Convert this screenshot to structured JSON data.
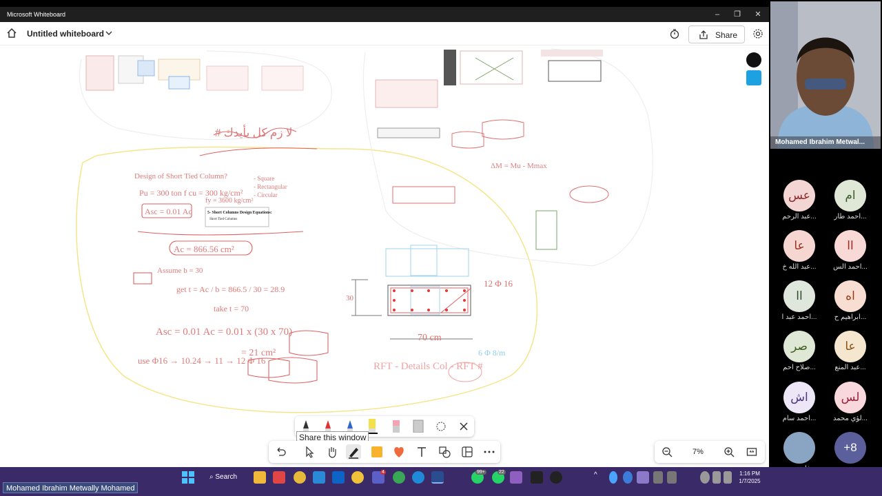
{
  "window": {
    "app_title": "Microsoft Whiteboard",
    "doc_title": "Untitled whiteboard",
    "share_label": "Share"
  },
  "board_notes": {
    "title_arabic": "# لا زم كل بأيدك",
    "design_heading": "Design of Short Tied Column?",
    "pu_line": "Pu = 300 ton  f cu = 300 kg/cm²",
    "fy_line": "fy = 3600 kg/cm²",
    "square": "- Square",
    "rectangular": "- Rectangular",
    "circular": "- Circular",
    "asc_formula": "Asc = 0.01 Ac",
    "eq_title": "5- Short Columns Design Equations:",
    "eq_subtitle": "Short Tied Columns",
    "ac_result": "Ac = 866.56 cm²",
    "assume": "Assume b = 30",
    "get_t": "get t = Ac / b = 866.5 / 30 = 28.9",
    "take": "take t = 70",
    "asc_calc": "Asc = 0.01 Ac = 0.01 x (30 x 70)",
    "asc_result": "= 21 cm²",
    "use": "use Φ16 → 10.24 → 11 → 12 Φ 16",
    "rft_label": "12 Φ 16",
    "dim_30": "30",
    "dim_70": "70 cm",
    "stirrups": "6 Φ 8/m",
    "rft_details": "RFT - Details Col - RFT #",
    "dm_line": "ΔM = Mu - Mmax"
  },
  "toolbar": {
    "tooltip": "Share this window",
    "zoom_value": "7%"
  },
  "teams": {
    "presenter_name": "Mohamed Ibrahim Metwal...",
    "attendees": [
      {
        "initials": "عس",
        "name": "عبد الرحم...",
        "bg": "#f3d6d4",
        "fg": "#8b2b2b"
      },
      {
        "initials": "ام",
        "name": "احمد طار...",
        "bg": "#dfe8d6",
        "fg": "#3c5a28"
      },
      {
        "initials": "عا",
        "name": "عبد الله خ...",
        "bg": "#f6d6d0",
        "fg": "#9b2e1c"
      },
      {
        "initials": "اا",
        "name": "احمد الس...",
        "bg": "#f8d9d6",
        "fg": "#a3261d"
      },
      {
        "initials": "اا",
        "name": "احمد عبد ا...",
        "bg": "#dfe6dc",
        "fg": "#2c4a2a"
      },
      {
        "initials": "اه",
        "name": "ابراهيم ح...",
        "bg": "#f7ddd2",
        "fg": "#9b3a12"
      },
      {
        "initials": "صر",
        "name": "صلاح احم...",
        "bg": "#dfe8d5",
        "fg": "#3f5d22"
      },
      {
        "initials": "عا",
        "name": "عبد المنع...",
        "bg": "#f4e6cf",
        "fg": "#8a5210"
      },
      {
        "initials": "اش",
        "name": "احمد سام...",
        "bg": "#ece6f6",
        "fg": "#4a3580"
      },
      {
        "initials": "لس",
        "name": "لؤي محمد...",
        "bg": "#f8d8dc",
        "fg": "#9a1f3a"
      },
      {
        "initials": "",
        "name": "فارس مم...",
        "bg": "#8aa4c4",
        "fg": "#fff"
      },
      {
        "initials": "+8",
        "name": "",
        "bg": "#5b5f9c",
        "fg": "#fff"
      }
    ]
  },
  "taskbar": {
    "presenter_banner": "Mohamed Ibrahim Metwally Mohamed",
    "search_label": "Search",
    "time": "1:16 PM",
    "date": "1/7/2025",
    "badge_99": "99+",
    "badge_22": "22",
    "badge_4": "4"
  },
  "colors": {
    "ink_red": "#e06060",
    "ink_yellow": "#f5e58a",
    "ink_blue": "#8fcfe8",
    "taskbar": "#3b2a68"
  }
}
